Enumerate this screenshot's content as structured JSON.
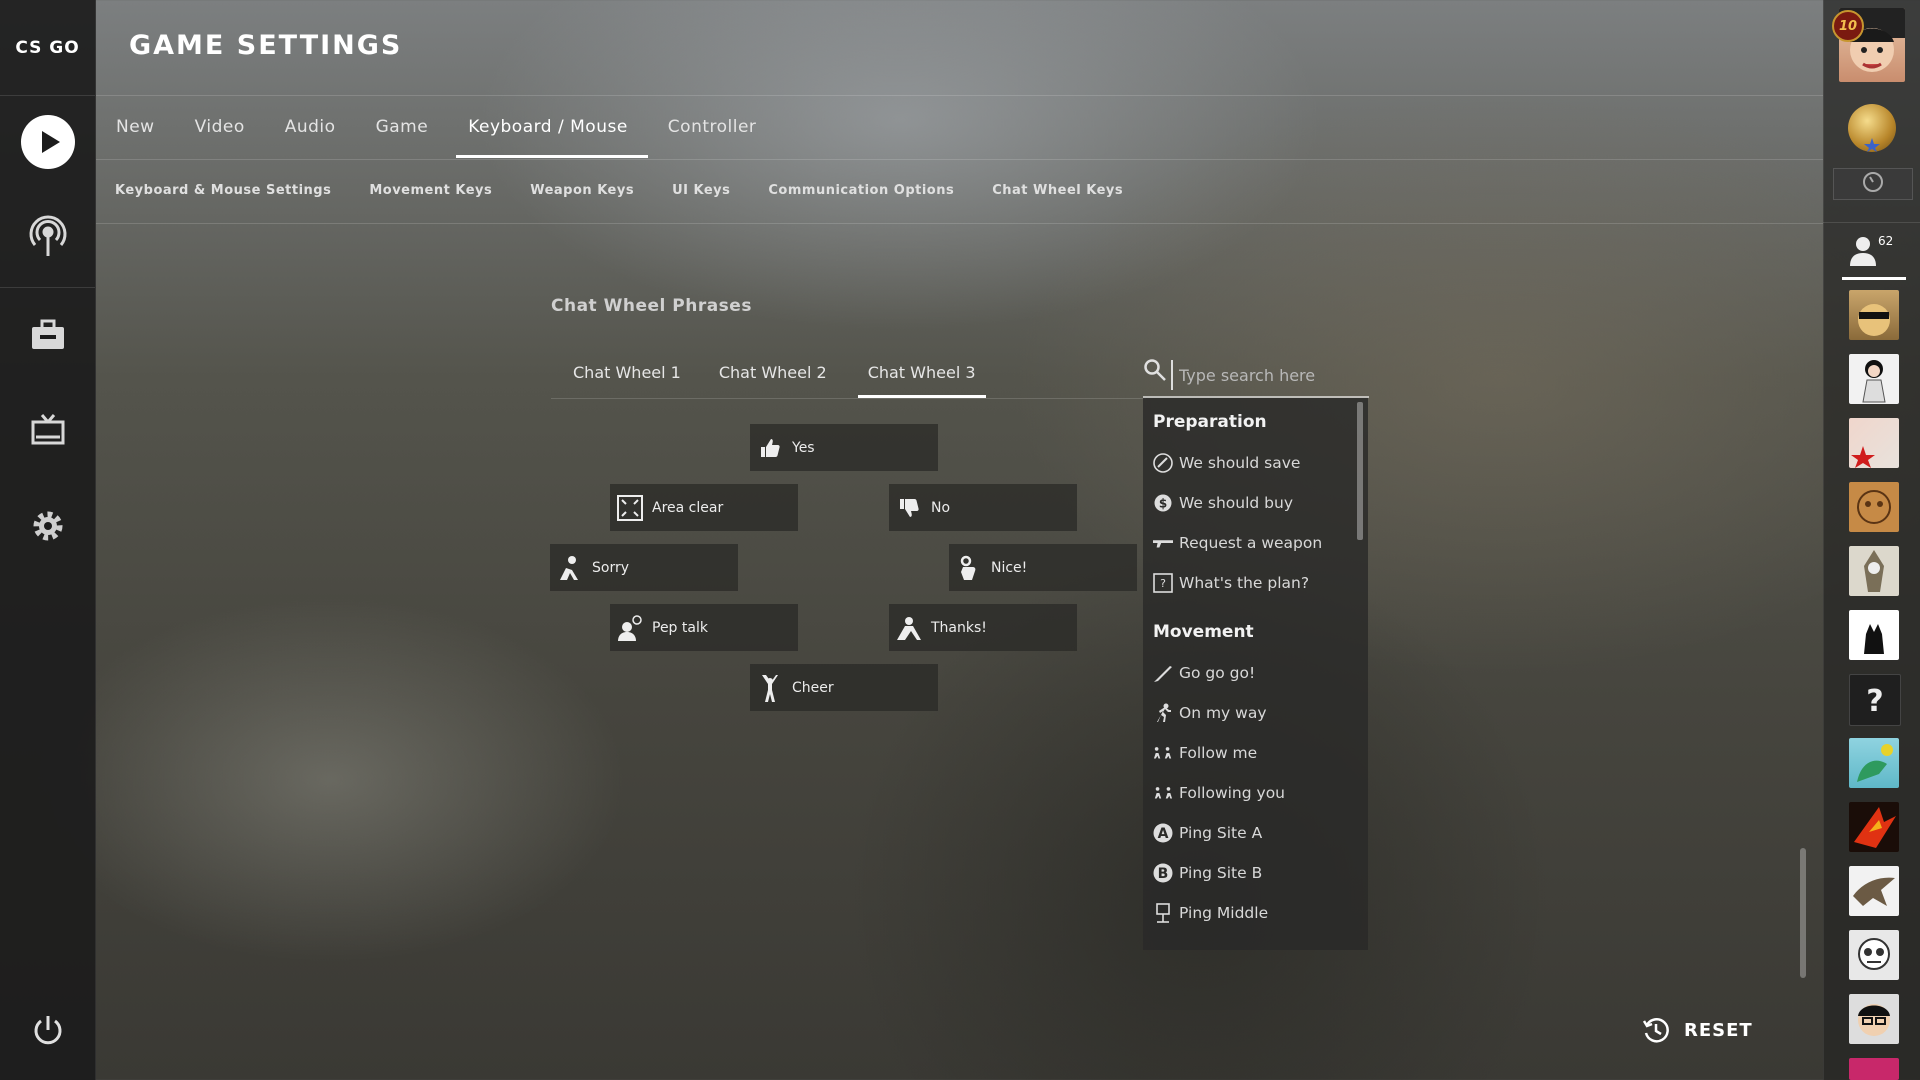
{
  "app": {
    "logo": "CS GO",
    "title": "GAME SETTINGS"
  },
  "nav": [
    {
      "icon": "play-icon"
    },
    {
      "icon": "broadcast-icon"
    },
    {
      "icon": "inventory-briefcase-icon"
    },
    {
      "icon": "watch-tv-icon"
    },
    {
      "icon": "settings-gear-icon"
    },
    {
      "icon": "power-icon"
    }
  ],
  "tabs": [
    "New",
    "Video",
    "Audio",
    "Game",
    "Keyboard / Mouse",
    "Controller"
  ],
  "active_tab": "Keyboard / Mouse",
  "subtabs": [
    "Keyboard & Mouse Settings",
    "Movement Keys",
    "Weapon Keys",
    "UI Keys",
    "Communication Options",
    "Chat Wheel Keys"
  ],
  "section_title": "Chat Wheel Phrases",
  "wheel_tabs": [
    "Chat Wheel 1",
    "Chat Wheel 2",
    "Chat Wheel 3"
  ],
  "active_wheel": "Chat Wheel 3",
  "search": {
    "placeholder": "Type search here",
    "value": ""
  },
  "wheel_phrases": [
    {
      "label": "Yes",
      "icon": "thumbs-up-icon"
    },
    {
      "label": "Area clear",
      "icon": "area-clear-icon"
    },
    {
      "label": "No",
      "icon": "thumbs-down-icon"
    },
    {
      "label": "Sorry",
      "icon": "sorry-icon"
    },
    {
      "label": "Nice!",
      "icon": "ok-hand-icon"
    },
    {
      "label": "Pep talk",
      "icon": "pep-talk-icon"
    },
    {
      "label": "Thanks!",
      "icon": "thanks-icon"
    },
    {
      "label": "Cheer",
      "icon": "cheer-icon"
    }
  ],
  "phrase_list": {
    "preparation_title": "Preparation",
    "preparation": [
      {
        "label": "We should save",
        "icon": "save-icon"
      },
      {
        "label": "We should buy",
        "icon": "dollar-icon"
      },
      {
        "label": "Request a weapon",
        "icon": "weapon-icon"
      },
      {
        "label": "What's the plan?",
        "icon": "plan-icon"
      }
    ],
    "movement_title": "Movement",
    "movement": [
      {
        "label": "Go go go!",
        "icon": "knife-icon"
      },
      {
        "label": "On my way",
        "icon": "running-icon"
      },
      {
        "label": "Follow me",
        "icon": "follow-me-icon"
      },
      {
        "label": "Following you",
        "icon": "following-icon"
      },
      {
        "label": "Ping Site A",
        "icon": "site-a-icon"
      },
      {
        "label": "Ping Site B",
        "icon": "site-b-icon"
      },
      {
        "label": "Ping Middle",
        "icon": "middle-icon"
      }
    ]
  },
  "reset_label": "RESET",
  "sidebar": {
    "level": "10",
    "friends_count": "62"
  },
  "colors": {
    "accent": "#ffffff",
    "panel": "#2a2a28",
    "nav": "#1c1c1c"
  }
}
